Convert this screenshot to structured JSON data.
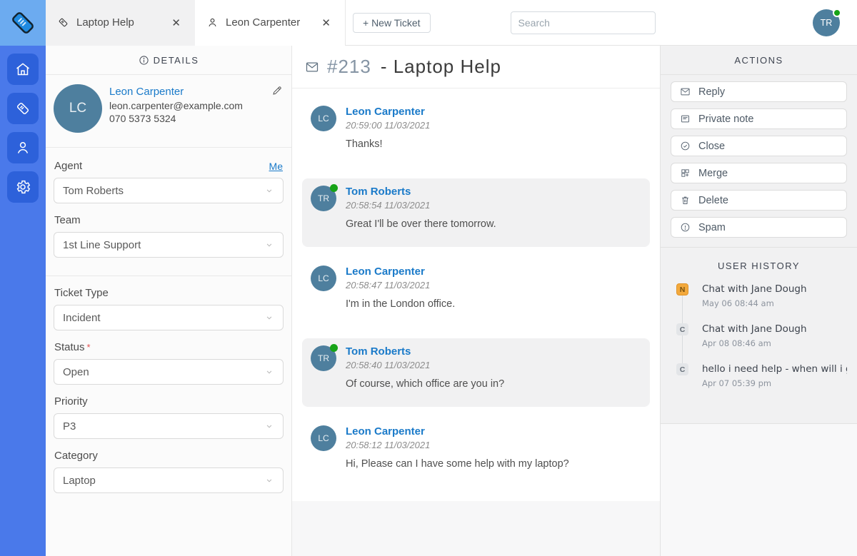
{
  "colors": {
    "sidebar_blue": "#4a79ea",
    "sidebar_button_blue": "#2d61da",
    "logo_tile_blue": "#6cabf0",
    "link_blue": "#1a7ac9",
    "avatar_steel_blue": "#4e7f9e",
    "online_green": "#17a317",
    "note_badge_orange": "#f3a93c",
    "required_red": "#e05252"
  },
  "topbar": {
    "tabs": [
      {
        "label": "Laptop Help",
        "icon": "ticket-icon"
      },
      {
        "label": "Leon Carpenter",
        "icon": "person-icon"
      }
    ],
    "close_glyph": "✕",
    "new_ticket_label": "+ New Ticket",
    "search_placeholder": "Search",
    "user_initials": "TR"
  },
  "details": {
    "header": "DETAILS",
    "contact": {
      "initials": "LC",
      "name": "Leon Carpenter",
      "email": "leon.carpenter@example.com",
      "phone": "070 5373 5324"
    },
    "agent_label": "Agent",
    "me_link": "Me",
    "agent_value": "Tom Roberts",
    "team_label": "Team",
    "team_value": "1st Line Support",
    "ticket_type_label": "Ticket Type",
    "ticket_type_value": "Incident",
    "status_label": "Status",
    "status_required_mark": "*",
    "status_value": "Open",
    "priority_label": "Priority",
    "priority_value": "P3",
    "category_label": "Category",
    "category_value": "Laptop"
  },
  "thread": {
    "ticket_id": "#213",
    "ticket_title": "- Laptop Help",
    "messages": [
      {
        "initials": "LC",
        "name": "Leon Carpenter",
        "time": "20:59:00 11/03/2021",
        "text": "Thanks!"
      },
      {
        "initials": "TR",
        "name": "Tom Roberts",
        "time": "20:58:54 11/03/2021",
        "text": "Great I'll be over there tomorrow."
      },
      {
        "initials": "LC",
        "name": "Leon Carpenter",
        "time": "20:58:47 11/03/2021",
        "text": "I'm in the London office."
      },
      {
        "initials": "TR",
        "name": "Tom Roberts",
        "time": "20:58:40 11/03/2021",
        "text": "Of course, which office are you in?"
      },
      {
        "initials": "LC",
        "name": "Leon Carpenter",
        "time": "20:58:12 11/03/2021",
        "text": "Hi, Please can I have some help with my laptop?"
      }
    ]
  },
  "actions": {
    "header": "ACTIONS",
    "items": [
      {
        "label": "Reply",
        "icon": "envelope-icon"
      },
      {
        "label": "Private note",
        "icon": "note-icon"
      },
      {
        "label": "Close",
        "icon": "check-circle-icon"
      },
      {
        "label": "Merge",
        "icon": "merge-icon"
      },
      {
        "label": "Delete",
        "icon": "trash-icon"
      },
      {
        "label": "Spam",
        "icon": "alert-circle-icon"
      }
    ]
  },
  "user_history": {
    "header": "USER HISTORY",
    "items": [
      {
        "badge": "N",
        "title": "Chat with Jane Dough",
        "date": "May 06 08:44 am"
      },
      {
        "badge": "C",
        "title": "Chat with Jane Dough",
        "date": "Apr 08 08:46 am"
      },
      {
        "badge": "C",
        "title": "hello i need help - when will i get",
        "date": "Apr 07 05:39 pm"
      }
    ]
  }
}
